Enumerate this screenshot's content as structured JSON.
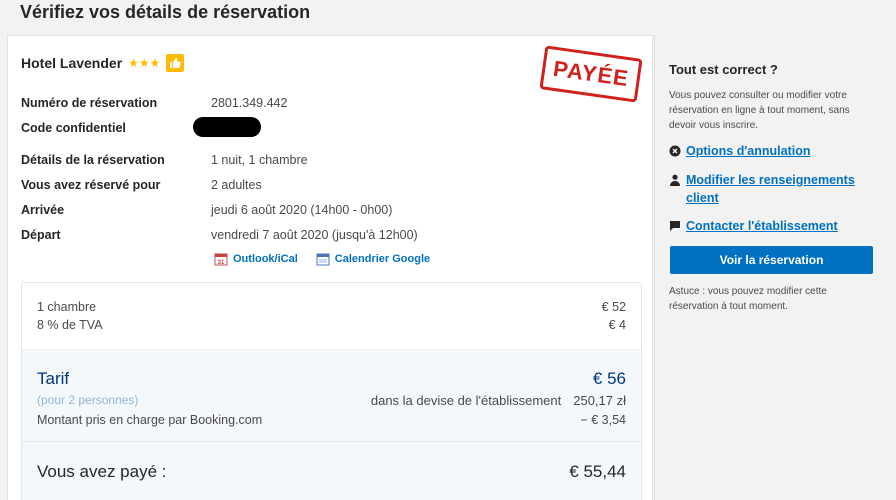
{
  "page": {
    "title": "Vérifiez vos détails de réservation"
  },
  "hotel": {
    "name": "Hotel Lavender",
    "stars": "★★★",
    "paid_stamp": "PAYÉE"
  },
  "details": [
    {
      "label": "Numéro de réservation",
      "value": "2801.349.442"
    },
    {
      "label": "Code confidentiel",
      "value": ""
    },
    {
      "label": "Détails de la réservation",
      "value": "1 nuit, 1 chambre"
    },
    {
      "label": "Vous avez réservé pour",
      "value": "2 adultes"
    },
    {
      "label": "Arrivée",
      "value": "jeudi 6 août 2020 (14h00 - 0h00)"
    },
    {
      "label": "Départ",
      "value": "vendredi 7 août 2020 (jusqu'à 12h00)"
    }
  ],
  "calendar": {
    "outlook": "Outlook/iCal",
    "google": "Calendrier Google"
  },
  "price": {
    "room_label": "1 chambre",
    "room_value": "€ 52",
    "vat_label": "8 % de TVA",
    "vat_value": "€ 4",
    "tarif_label": "Tarif",
    "tarif_value": "€ 56",
    "persons": "(pour 2 personnes)",
    "currency_label": "dans la devise de l'établissement",
    "currency_value": "250,17 zł",
    "covered_label": "Montant pris en charge par Booking.com",
    "covered_value": "− € 3,54",
    "paid_label": "Vous avez payé :",
    "paid_value": "€ 55,44"
  },
  "sidebar": {
    "title": "Tout est correct ?",
    "intro": "Vous pouvez consulter ou modifier votre réservation en ligne à tout moment, sans devoir vous inscrire.",
    "cancel_link": "Options d'annulation",
    "modify_link": "Modifier les renseignements client",
    "contact_link": "Contacter l'établissement",
    "view_button": "Voir la réservation",
    "tip": "Astuce : vous pouvez modifier cette réservation à tout moment."
  },
  "colors": {
    "brand_blue": "#0071c2",
    "dark_blue": "#003580",
    "star_yellow": "#febb02",
    "stamp_red": "#d0211c"
  }
}
